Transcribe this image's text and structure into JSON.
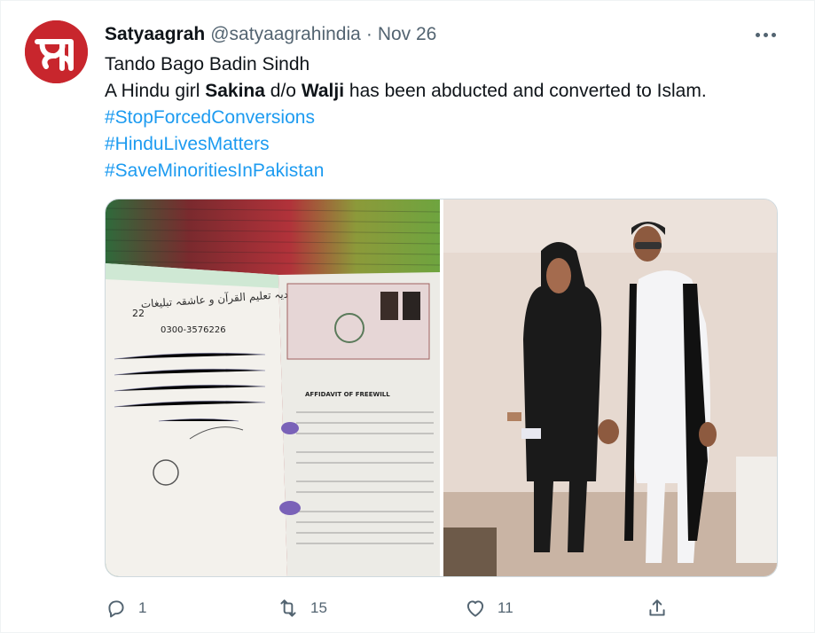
{
  "tweet": {
    "author_name": "Satyaagrah",
    "handle": "@satyaagrahindia",
    "separator": "·",
    "date": "Nov 26",
    "avatar_letter": "स",
    "line1": "Tando Bago Badin Sindh",
    "line2_a": "A Hindu girl ",
    "line2_b": "Sakina",
    "line2_c": " d/o ",
    "line2_d": "Walji",
    "line2_e": " has been abducted and converted to Islam.",
    "hashtags": [
      "#StopForcedConversions",
      "#HinduLivesMatters",
      "#SaveMinoritiesInPakistan"
    ]
  },
  "media": {
    "photo1": {
      "title_urdu": "جامعہ محمدیہ تعلیم القرآن و عاشقہ تبلیغات",
      "number": "22",
      "phone": "0300-3576226",
      "affidavit_title": "AFFIDAVIT OF FREEWILL"
    }
  },
  "actions": {
    "reply_count": "1",
    "retweet_count": "15",
    "like_count": "11"
  },
  "colors": {
    "accent": "#1d9bf0",
    "secondary_text": "#536471",
    "avatar_bg": "#c8262d"
  }
}
